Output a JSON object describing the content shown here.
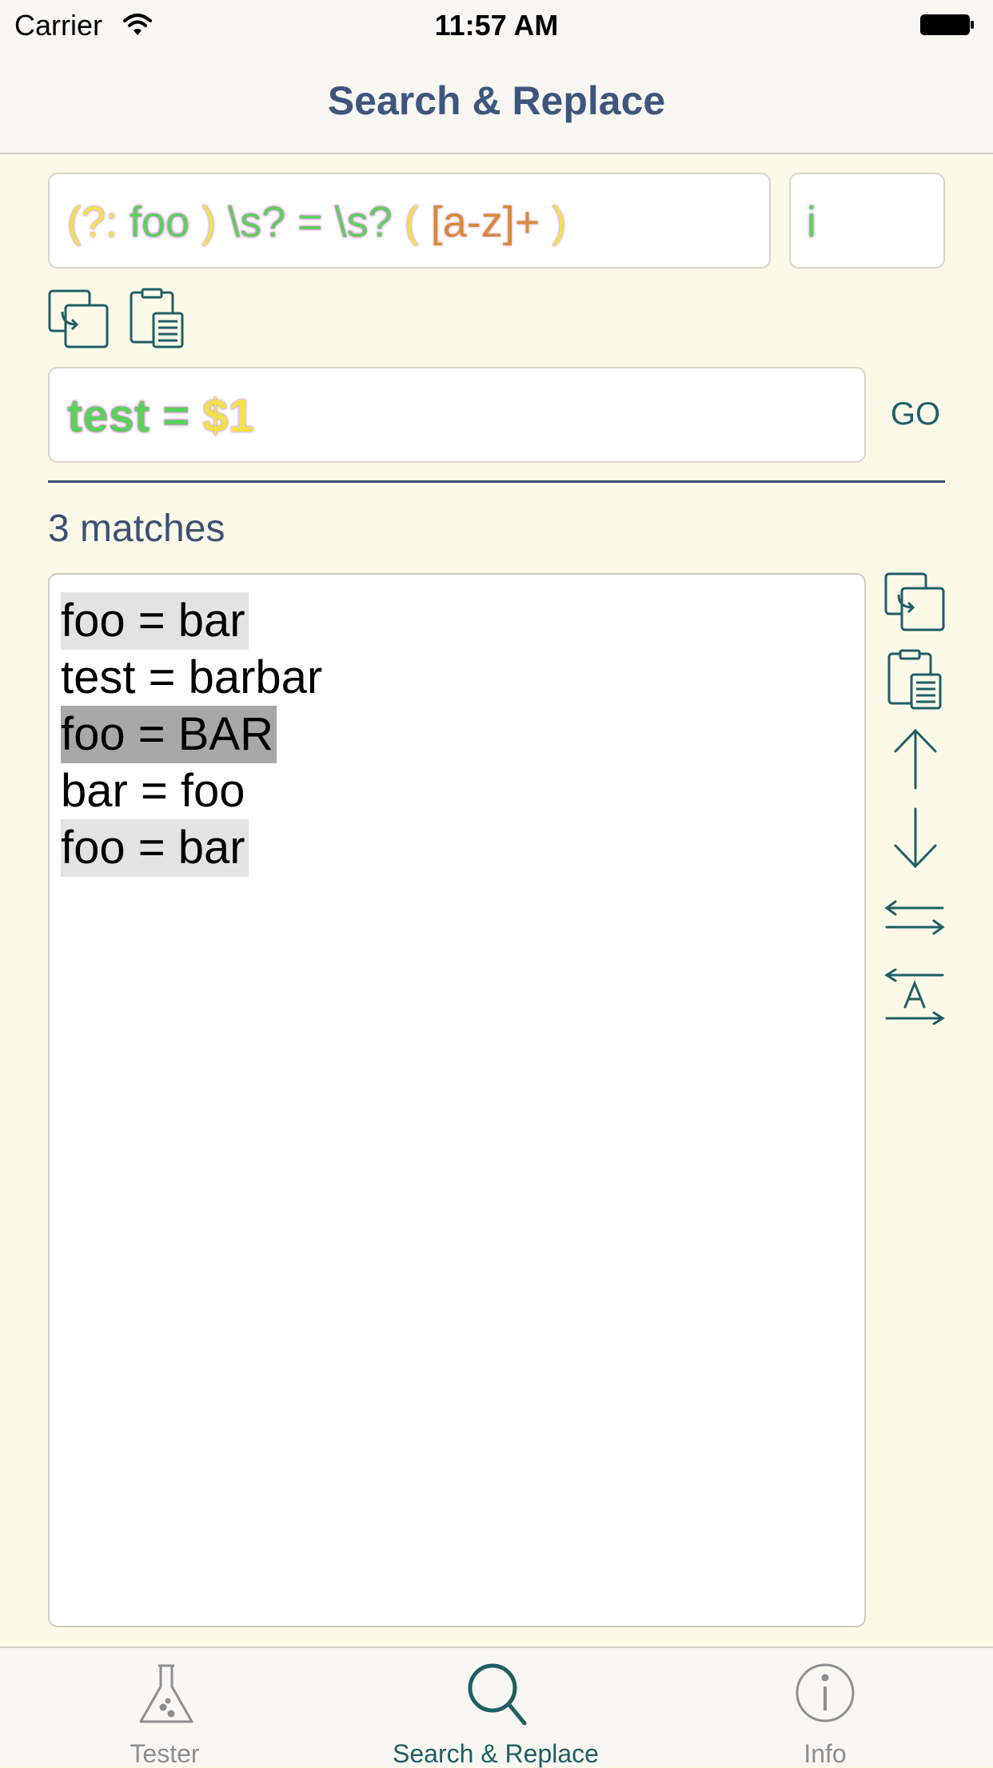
{
  "status_bar": {
    "carrier": "Carrier",
    "time": "11:57 AM"
  },
  "nav": {
    "title": "Search & Replace"
  },
  "search": {
    "pattern_tokens": [
      {
        "text": "(?:",
        "color": "yellow"
      },
      {
        "text": " foo ",
        "color": "green"
      },
      {
        "text": ")",
        "color": "yellow"
      },
      {
        "text": " \\s? = \\s? ",
        "color": "green"
      },
      {
        "text": "(",
        "color": "yellow"
      },
      {
        "text": " [a-z]+ ",
        "color": "orange"
      },
      {
        "text": ")",
        "color": "yellow"
      }
    ],
    "flags": "i"
  },
  "replace": {
    "tokens": [
      {
        "text": "test = ",
        "color": "green"
      },
      {
        "text": "$1",
        "color": "yellow"
      }
    ],
    "go_label": "GO"
  },
  "results": {
    "match_count": "3 matches",
    "lines": [
      {
        "text": "foo = bar",
        "highlight": "light"
      },
      {
        "text": "test = barbar",
        "highlight": "none"
      },
      {
        "text": "foo = BAR",
        "highlight": "dark"
      },
      {
        "text": "bar = foo",
        "highlight": "none"
      },
      {
        "text": "foo = bar",
        "highlight": "light"
      }
    ]
  },
  "toolbar_icons": [
    "paste-replace-icon",
    "clipboard-icon"
  ],
  "side_icons": [
    "paste-replace-icon",
    "clipboard-icon",
    "arrow-up-icon",
    "arrow-down-icon",
    "swap-arrows-icon",
    "swap-text-icon"
  ],
  "tabs": [
    {
      "label": "Tester",
      "icon": "flask-icon",
      "active": false
    },
    {
      "label": "Search & Replace",
      "icon": "search-icon",
      "active": true
    },
    {
      "label": "Info",
      "icon": "info-icon",
      "active": false
    }
  ],
  "colors": {
    "accent": "#1f5e66",
    "title": "#3e567f",
    "background": "#fdf9e9",
    "inactive_tab": "#8e8e8e"
  }
}
